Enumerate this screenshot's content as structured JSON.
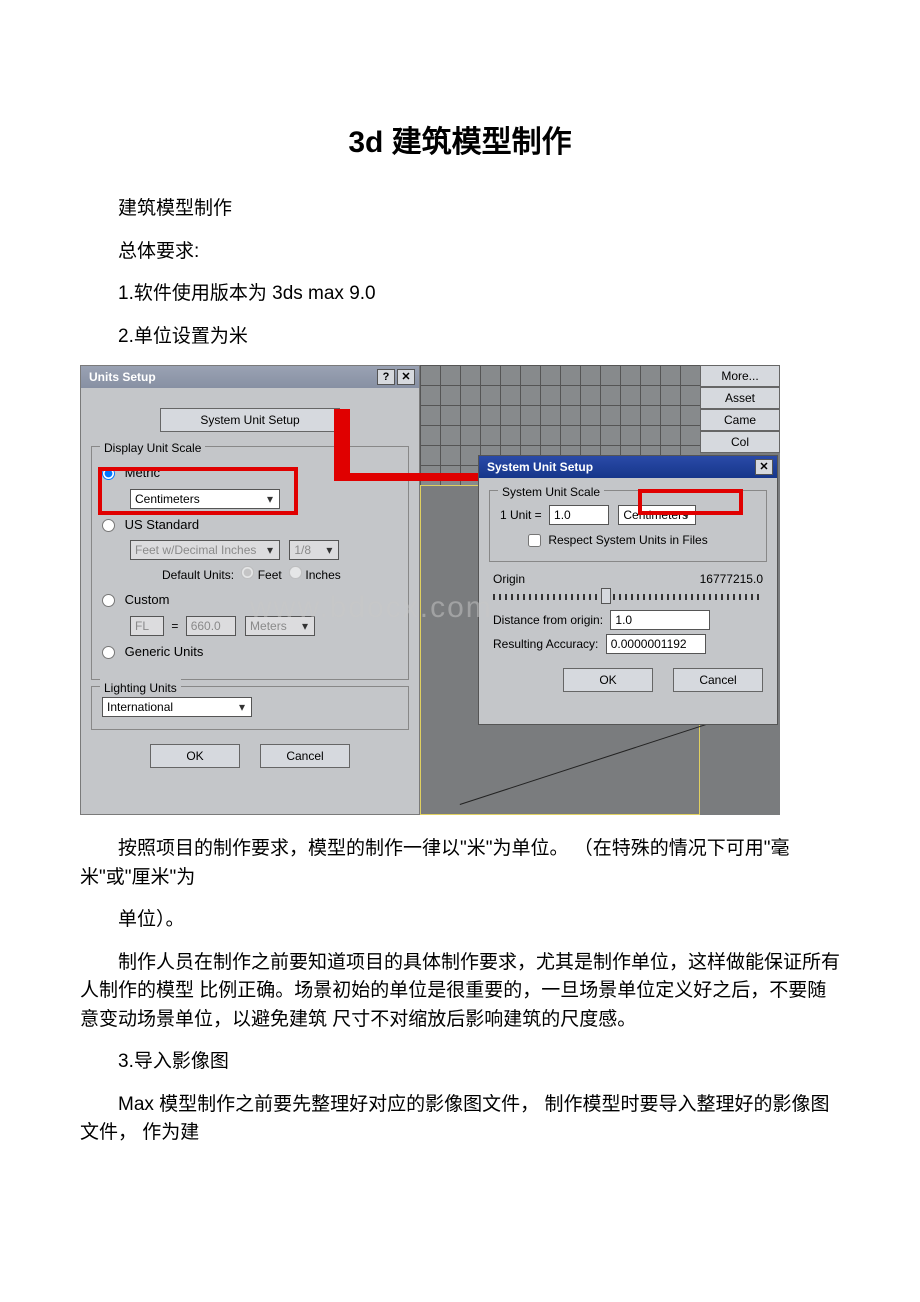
{
  "title": "3d 建筑模型制作",
  "p1": "建筑模型制作",
  "p2": "总体要求:",
  "p3": "1.软件使用版本为 3ds max 9.0",
  "p4": "2.单位设置为米",
  "p5": "按照项目的制作要求，模型的制作一律以\"米\"为单位。 （在特殊的情况下可用\"毫米\"或\"厘米\"为",
  "p6": "单位）。",
  "p7": "制作人员在制作之前要知道项目的具体制作要求，尤其是制作单位，这样做能保证所有人制作的模型 比例正确。场景初始的单位是很重要的，一旦场景单位定义好之后，不要随意变动场景单位，以避免建筑 尺寸不对缩放后影响建筑的尺度感。",
  "p8": "3.导入影像图",
  "p9": "Max 模型制作之前要先整理好对应的影像图文件， 制作模型时要导入整理好的影像图文件， 作为建",
  "dlg1": {
    "title": "Units Setup",
    "help_icon": "?",
    "close_icon": "✕",
    "sys_btn": "System Unit Setup",
    "g1_legend": "Display Unit Scale",
    "metric_label": "Metric",
    "metric_value": "Centimeters",
    "us_label": "US Standard",
    "us_combo1": "Feet w/Decimal Inches",
    "us_combo2": "1/8",
    "default_units": "Default Units:",
    "feet_label": "Feet",
    "inches_label": "Inches",
    "custom_label": "Custom",
    "custom_prefix": "FL",
    "custom_eq": "=",
    "custom_val": "660.0",
    "custom_unit": "Meters",
    "generic_label": "Generic Units",
    "g2_legend": "Lighting Units",
    "lighting_value": "International",
    "ok": "OK",
    "cancel": "Cancel"
  },
  "dlg2": {
    "title": "System Unit Setup",
    "close_icon": "✕",
    "legend": "System Unit Scale",
    "unit_label": "1 Unit =",
    "unit_value": "1.0",
    "unit_combo": "Centimeters",
    "respect": "Respect System Units in Files",
    "origin_label": "Origin",
    "origin_value": "16777215.0",
    "dist_label": "Distance from origin:",
    "dist_value": "1.0",
    "acc_label": "Resulting Accuracy:",
    "acc_value": "0.0000001192",
    "ok": "OK",
    "cancel": "Cancel"
  },
  "stack": {
    "b1": "More...",
    "b2": "Asset",
    "b3": "Came",
    "b4": "Col"
  },
  "watermark": "www.bdocx.com"
}
